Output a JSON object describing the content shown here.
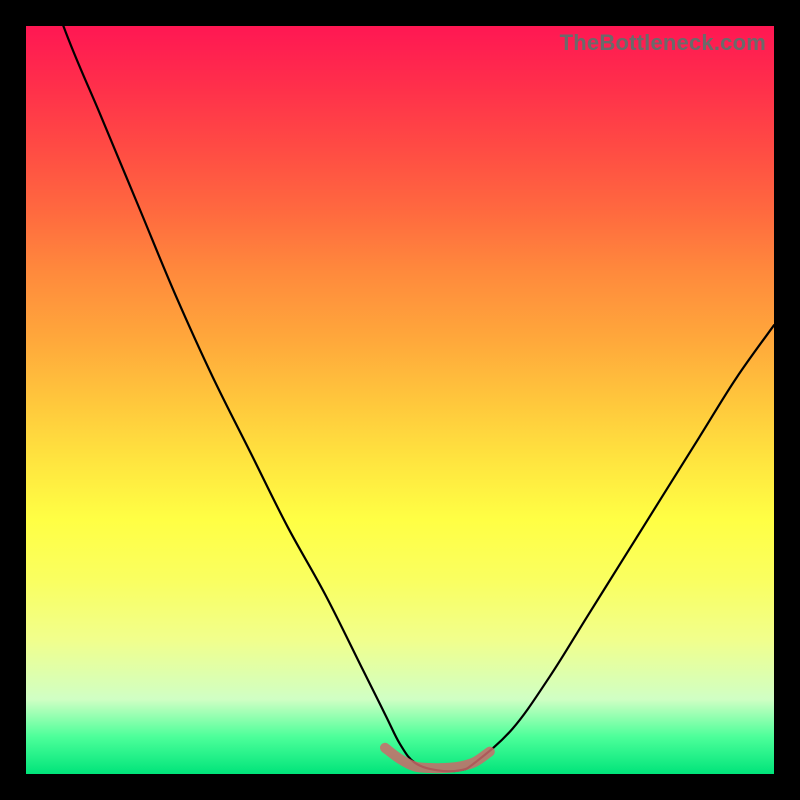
{
  "watermark": "TheBottleneck.com",
  "chart_data": {
    "type": "line",
    "title": "",
    "xlabel": "",
    "ylabel": "",
    "xlim": [
      0,
      100
    ],
    "ylim": [
      0,
      100
    ],
    "grid": false,
    "legend": false,
    "series": [
      {
        "name": "bottleneck-curve",
        "color": "#000000",
        "x": [
          0,
          5,
          10,
          15,
          20,
          25,
          30,
          35,
          40,
          45,
          48,
          50,
          52,
          55,
          58,
          60,
          65,
          70,
          75,
          80,
          85,
          90,
          95,
          100
        ],
        "y": [
          115,
          100,
          88,
          76,
          64,
          53,
          43,
          33,
          24,
          14,
          8,
          4,
          1.5,
          0.5,
          0.5,
          1.5,
          6,
          13,
          21,
          29,
          37,
          45,
          53,
          60
        ]
      },
      {
        "name": "trough-overlay",
        "color": "#cb6a6a",
        "x": [
          48,
          50,
          52,
          54,
          56,
          58,
          60,
          62
        ],
        "y": [
          3.5,
          2.0,
          1.0,
          0.8,
          0.8,
          1.0,
          1.6,
          3.0
        ]
      }
    ]
  }
}
